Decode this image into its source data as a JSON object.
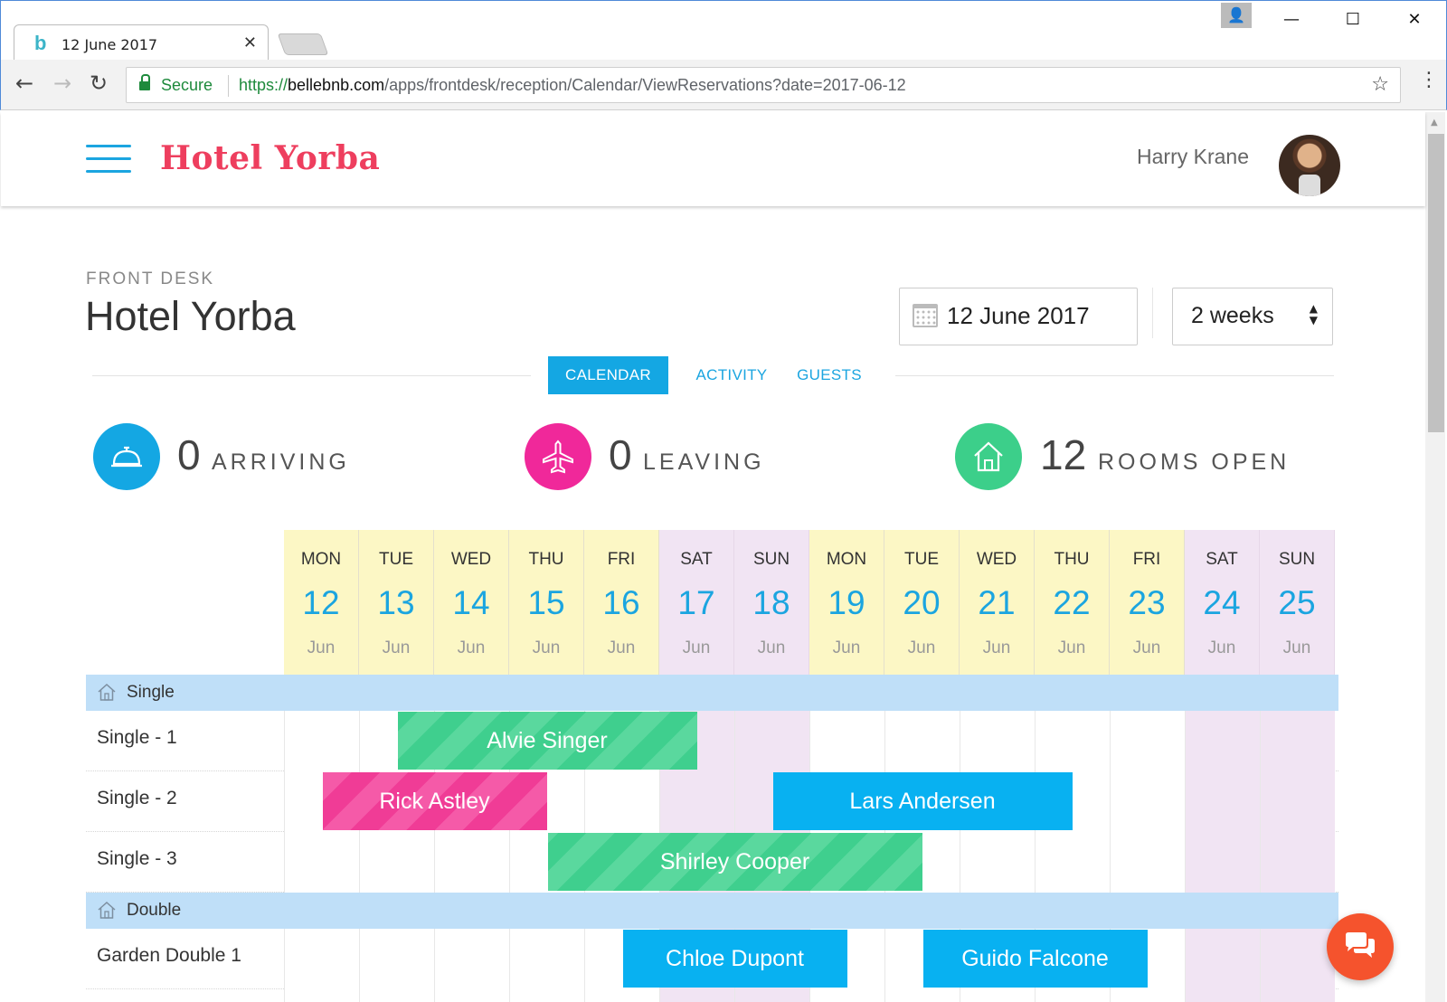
{
  "browser": {
    "tab_title": "12 June 2017",
    "tab_favicon": "b",
    "tab_close": "✕",
    "secure_label": "Secure",
    "url_scheme": "https://",
    "url_host": "bellebnb.com",
    "url_path": "/apps/frontdesk/reception/Calendar/ViewReservations?date=2017-06-12",
    "controls": {
      "back": "←",
      "forward": "→",
      "reload": "↻",
      "bookmark": "☆",
      "menu": "⋮",
      "minimize": "—",
      "maximize": "☐",
      "close": "✕",
      "user": "👤"
    }
  },
  "header": {
    "brand": "Hotel Yorba",
    "user_name": "Harry Krane"
  },
  "page": {
    "kicker": "FRONT DESK",
    "title": "Hotel Yorba",
    "date": "12 June 2017",
    "range": "2 weeks",
    "range_arrows": "▲▼"
  },
  "tabs": [
    {
      "label": "CALENDAR",
      "active": true
    },
    {
      "label": "ACTIVITY",
      "active": false
    },
    {
      "label": "GUESTS",
      "active": false
    }
  ],
  "stats": [
    {
      "value": "0",
      "label": "ARRIVING",
      "icon": "bell-icon",
      "color": "#14a7e3"
    },
    {
      "value": "0",
      "label": "LEAVING",
      "icon": "airplane-icon",
      "color": "#f0289a"
    },
    {
      "value": "12",
      "label": "ROOMS OPEN",
      "icon": "house-icon",
      "color": "#3ccf8a"
    }
  ],
  "calendar": {
    "days": [
      {
        "dow": "MON",
        "day": "12",
        "month": "Jun",
        "weekend": false
      },
      {
        "dow": "TUE",
        "day": "13",
        "month": "Jun",
        "weekend": false
      },
      {
        "dow": "WED",
        "day": "14",
        "month": "Jun",
        "weekend": false
      },
      {
        "dow": "THU",
        "day": "15",
        "month": "Jun",
        "weekend": false
      },
      {
        "dow": "FRI",
        "day": "16",
        "month": "Jun",
        "weekend": false
      },
      {
        "dow": "SAT",
        "day": "17",
        "month": "Jun",
        "weekend": true
      },
      {
        "dow": "SUN",
        "day": "18",
        "month": "Jun",
        "weekend": true
      },
      {
        "dow": "MON",
        "day": "19",
        "month": "Jun",
        "weekend": false
      },
      {
        "dow": "TUE",
        "day": "20",
        "month": "Jun",
        "weekend": false
      },
      {
        "dow": "WED",
        "day": "21",
        "month": "Jun",
        "weekend": false
      },
      {
        "dow": "THU",
        "day": "22",
        "month": "Jun",
        "weekend": false
      },
      {
        "dow": "FRI",
        "day": "23",
        "month": "Jun",
        "weekend": false
      },
      {
        "dow": "SAT",
        "day": "24",
        "month": "Jun",
        "weekend": true
      },
      {
        "dow": "SUN",
        "day": "25",
        "month": "Jun",
        "weekend": true
      }
    ],
    "groups": [
      {
        "name": "Single",
        "rooms": [
          {
            "name": "Single - 1",
            "bookings": [
              {
                "guest": "Alvie Singer",
                "start_day": 1.5,
                "end_day": 5.5,
                "color": "green"
              }
            ]
          },
          {
            "name": "Single - 2",
            "bookings": [
              {
                "guest": "Rick Astley",
                "start_day": 0.5,
                "end_day": 3.5,
                "color": "pink"
              },
              {
                "guest": "Lars Andersen",
                "start_day": 6.5,
                "end_day": 10.5,
                "color": "blue"
              }
            ]
          },
          {
            "name": "Single - 3",
            "bookings": [
              {
                "guest": "Shirley Cooper",
                "start_day": 3.5,
                "end_day": 8.5,
                "color": "green"
              }
            ]
          }
        ]
      },
      {
        "name": "Double",
        "rooms": [
          {
            "name": "Garden Double 1",
            "bookings": [
              {
                "guest": "Chloe Dupont",
                "start_day": 4.5,
                "end_day": 7.5,
                "color": "blue"
              },
              {
                "guest": "Guido Falcone",
                "start_day": 8.5,
                "end_day": 11.5,
                "color": "blue"
              }
            ]
          },
          {
            "name": "",
            "bookings": []
          }
        ]
      }
    ]
  },
  "colors": {
    "accent": "#14a7e3",
    "brand": "#ee3e5e",
    "weekday_header": "#fcf7c5",
    "weekend": "#f1e4f3",
    "group_row": "#bfdff8",
    "chat": "#f5532d"
  }
}
